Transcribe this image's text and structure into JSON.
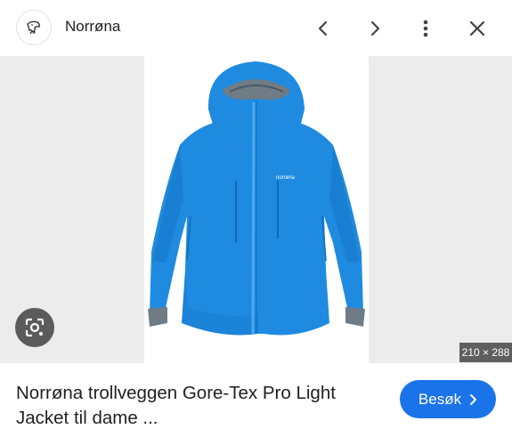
{
  "header": {
    "site_name": "Norrøna",
    "logo_icon": "norrona-logo",
    "buttons": {
      "prev": "chevron-left-icon",
      "next": "chevron-right-icon",
      "more": "more-vert-icon",
      "close": "close-icon"
    }
  },
  "viewer": {
    "dimensions": "210 × 288",
    "lens_icon": "lens-search-icon",
    "jacket_color": "#1e8be0",
    "background_color": "#ececec"
  },
  "result": {
    "title_line1": "Norrøna trollveggen Gore-Tex Pro Light",
    "title_line2": "Jacket til dame ...",
    "visit_label": "Besøk",
    "accent_color": "#1a73e8"
  }
}
